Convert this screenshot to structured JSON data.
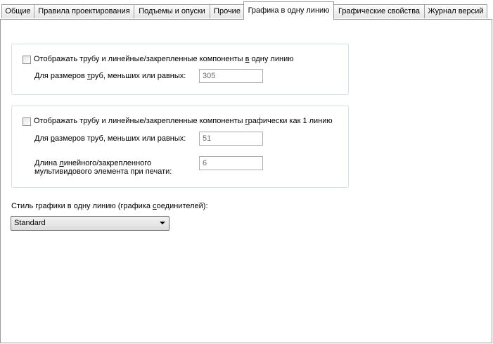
{
  "tabs": [
    {
      "label": "Общие"
    },
    {
      "label": "Правила проектирования"
    },
    {
      "label": "Подъемы и опуски"
    },
    {
      "label": "Прочие"
    },
    {
      "label": "Графика в одну линию"
    },
    {
      "label": "Графические свойства"
    },
    {
      "label": "Журнал версий"
    }
  ],
  "group1": {
    "checkbox_pre": "Отображать трубу и линейные/закрепленные компоненты ",
    "checkbox_u": "в",
    "checkbox_post": " одну линию",
    "checked": false,
    "size_label_pre": "Для размеров ",
    "size_label_u": "т",
    "size_label_post": "руб, меньших или равных:",
    "size_value": "305"
  },
  "group2": {
    "checkbox_pre": "Отображать трубу и линейные/закрепленные компоненты ",
    "checkbox_u": "г",
    "checkbox_post": "рафически как 1 линию",
    "checked": false,
    "size_label_pre": "Для ",
    "size_label_u": "р",
    "size_label_post": "азмеров труб, меньших или равных:",
    "size_value": "51",
    "length_label_line1_pre": "Длина ",
    "length_label_line1_u": "л",
    "length_label_line1_post": "инейного/закрепленного",
    "length_label_line2": "мультивидового элемента при печати:",
    "length_value": "6"
  },
  "style": {
    "label_pre": "Стиль графики в одну линию (графика ",
    "label_u": "с",
    "label_post": "оединителей):",
    "selected": "Standard"
  }
}
